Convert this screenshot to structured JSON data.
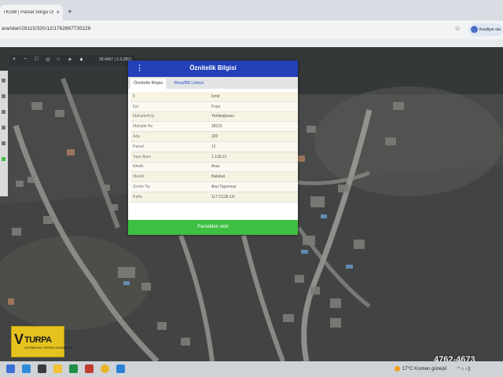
{
  "browser": {
    "tab_title": "TKGM | Parsel Sorgu Uygulaması",
    "tab_close": "×",
    "new_tab": "+",
    "url": "ara/idari/28115/320/12/1762867735228",
    "star": "☆",
    "profile_label": "Kesiliyor ola"
  },
  "map_toolbar": {
    "items": [
      "+",
      "−",
      "□",
      "⊙",
      "○",
      "✦",
      "▲"
    ],
    "scale_text": "28.4467  | 1:3.2891"
  },
  "dialog": {
    "menu_icon": "⋮",
    "title": "Öznitelik Bilgisi",
    "tabs": [
      {
        "label": "Öznitelik Bilgisi"
      },
      {
        "label": "Bina/BB Listesi"
      }
    ],
    "rows": [
      {
        "label": "İl",
        "value": "İzmir"
      },
      {
        "label": "İlçe",
        "value": "Foça"
      },
      {
        "label": "Mahalle/Köy",
        "value": "Yenibağarası"
      },
      {
        "label": "Mahalle No",
        "value": "28115"
      },
      {
        "label": "Ada",
        "value": "320"
      },
      {
        "label": "Parsel",
        "value": "12"
      },
      {
        "label": "Tapu Alanı",
        "value": "1.118,13"
      },
      {
        "label": "Nitelik",
        "value": "Arsa"
      },
      {
        "label": "Mevkii",
        "value": "Balabat"
      },
      {
        "label": "Zemin Tip",
        "value": "Ana Taşınmaz"
      },
      {
        "label": "Pafta",
        "value": "117-C12b-1A"
      }
    ],
    "button_label": "Parselden eklir"
  },
  "logo": {
    "mark": "V",
    "name": "TURPA",
    "tagline": "GAYRİMENKUL YATIRIM & DANIŞMANLIK"
  },
  "reference_code": "4762-4673",
  "taskbar": {
    "weather_temp": "17°C",
    "weather_text": "Kısmen güneşli",
    "tray": "^  ⌂  ◁)"
  },
  "colors": {
    "dialog_header": "#2340b8",
    "dialog_button": "#3fbf43",
    "logo_yellow": "#e6c21f"
  }
}
